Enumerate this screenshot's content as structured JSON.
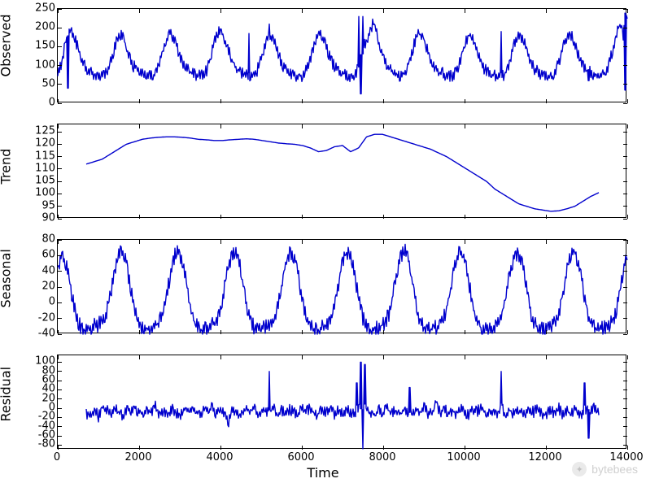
{
  "line_color": "#0000cd",
  "xlabel": "Time",
  "watermark": "bytebees",
  "chart_data": [
    {
      "type": "line",
      "ylabel": "Observed",
      "xlim": [
        0,
        14000
      ],
      "ylim": [
        0,
        250
      ],
      "xticks": [
        0,
        2000,
        4000,
        6000,
        8000,
        10000,
        12000,
        14000
      ],
      "yticks": [
        0,
        50,
        100,
        150,
        200,
        250
      ],
      "x_step": 100,
      "values": [
        80,
        120,
        180,
        200,
        180,
        150,
        120,
        100,
        90,
        85,
        80,
        80,
        95,
        130,
        170,
        190,
        175,
        140,
        110,
        95,
        85,
        80,
        80,
        80,
        100,
        135,
        175,
        195,
        180,
        145,
        115,
        100,
        90,
        85,
        82,
        80,
        100,
        140,
        180,
        200,
        185,
        150,
        120,
        100,
        90,
        85,
        80,
        80,
        95,
        130,
        170,
        190,
        175,
        140,
        110,
        95,
        85,
        80,
        80,
        80,
        100,
        135,
        175,
        195,
        180,
        145,
        115,
        100,
        90,
        85,
        82,
        80,
        95,
        130,
        170,
        190,
        230,
        175,
        140,
        110,
        95,
        85,
        80,
        80,
        100,
        135,
        175,
        195,
        180,
        145,
        115,
        100,
        90,
        85,
        82,
        80,
        95,
        130,
        170,
        190,
        175,
        140,
        110,
        95,
        85,
        80,
        80,
        80,
        95,
        130,
        170,
        190,
        175,
        140,
        110,
        95,
        85,
        80,
        80,
        80,
        100,
        135,
        175,
        195,
        180,
        145,
        115,
        100,
        90,
        85,
        82,
        80,
        95,
        130,
        170,
        225,
        190,
        240
      ],
      "spikes": [
        {
          "x": 250,
          "y": 40
        },
        {
          "x": 4700,
          "y": 185
        },
        {
          "x": 5200,
          "y": 210
        },
        {
          "x": 7400,
          "y": 230
        },
        {
          "x": 7450,
          "y": 25
        },
        {
          "x": 7500,
          "y": 230
        },
        {
          "x": 10900,
          "y": 190
        },
        {
          "x": 13050,
          "y": 60
        },
        {
          "x": 13950,
          "y": 35
        }
      ]
    },
    {
      "type": "line",
      "ylabel": "Trend",
      "xlim": [
        0,
        14000
      ],
      "ylim": [
        90,
        128
      ],
      "xticks": [
        0,
        2000,
        4000,
        6000,
        8000,
        10000,
        12000,
        14000
      ],
      "yticks": [
        90,
        95,
        100,
        105,
        110,
        115,
        120,
        125
      ],
      "x_step": 200,
      "x_start": 700,
      "x_end": 13300,
      "values": [
        112,
        113,
        114,
        116,
        118,
        120,
        121,
        122,
        122.5,
        122.8,
        123,
        123,
        122.8,
        122.5,
        122,
        121.8,
        121.5,
        121.5,
        121.8,
        122,
        122.2,
        122,
        121.5,
        121,
        120.5,
        120.2,
        120,
        119.5,
        118.5,
        117,
        117.5,
        119,
        119.5,
        117,
        118.5,
        123,
        124,
        124,
        123,
        122,
        121,
        120,
        119,
        118,
        116.5,
        115,
        113,
        111,
        109,
        107,
        105,
        102,
        100,
        98,
        96,
        95,
        94,
        93.5,
        93,
        93.2,
        94,
        95,
        97,
        99,
        100.5
      ],
      "spikes": []
    },
    {
      "type": "line",
      "ylabel": "Seasonal",
      "xlim": [
        0,
        14000
      ],
      "ylim": [
        -40,
        80
      ],
      "xticks": [
        0,
        2000,
        4000,
        6000,
        8000,
        10000,
        12000,
        14000
      ],
      "yticks": [
        -40,
        -20,
        0,
        20,
        40,
        60,
        80
      ],
      "x_step": 100,
      "values": [
        50,
        65,
        55,
        30,
        0,
        -20,
        -28,
        -30,
        -28,
        -25,
        -22,
        -20,
        -10,
        15,
        45,
        65,
        70,
        55,
        25,
        -5,
        -22,
        -28,
        -30,
        -28,
        -25,
        -20,
        -10,
        15,
        45,
        65,
        70,
        55,
        25,
        -5,
        -22,
        -28,
        -30,
        -28,
        -25,
        -20,
        -10,
        15,
        45,
        65,
        70,
        55,
        25,
        -5,
        -22,
        -28,
        -30,
        -28,
        -25,
        -20,
        -10,
        15,
        45,
        65,
        70,
        55,
        25,
        -5,
        -22,
        -28,
        -30,
        -28,
        -25,
        -20,
        -10,
        15,
        45,
        65,
        70,
        55,
        25,
        -5,
        -22,
        -28,
        -30,
        -28,
        -25,
        -20,
        -10,
        15,
        45,
        65,
        70,
        55,
        25,
        -5,
        -22,
        -28,
        -30,
        -28,
        -25,
        -20,
        -10,
        15,
        45,
        65,
        70,
        55,
        25,
        -5,
        -22,
        -28,
        -30,
        -28,
        -25,
        -20,
        -10,
        15,
        45,
        65,
        70,
        55,
        25,
        -5,
        -22,
        -28,
        -30,
        -28,
        -25,
        -20,
        -10,
        15,
        45,
        65,
        70,
        55,
        25,
        -5,
        -22,
        -28,
        -30,
        -28,
        -25,
        -20,
        -10,
        15,
        45,
        65
      ],
      "spikes": []
    },
    {
      "type": "line",
      "ylabel": "Residual",
      "xlim": [
        0,
        14000
      ],
      "ylim": [
        -90,
        115
      ],
      "xticks": [
        0,
        2000,
        4000,
        6000,
        8000,
        10000,
        12000,
        14000
      ],
      "yticks": [
        -80,
        -60,
        -40,
        -20,
        0,
        20,
        40,
        60,
        80,
        100
      ],
      "x_step": 100,
      "x_start": 700,
      "x_end": 13300,
      "values": [
        -5,
        -8,
        3,
        -12,
        8,
        2,
        -6,
        4,
        -3,
        -10,
        6,
        -2,
        8,
        -5,
        -7,
        3,
        -4,
        10,
        -8,
        2,
        -6,
        4,
        -3,
        -10,
        6,
        -2,
        8,
        -5,
        -7,
        3,
        -4,
        10,
        -8,
        2,
        -6,
        -25,
        4,
        -3,
        -10,
        6,
        -2,
        8,
        -5,
        -7,
        3,
        -4,
        10,
        -8,
        2,
        -6,
        4,
        -3,
        -10,
        6,
        -2,
        8,
        -5,
        -7,
        3,
        -4,
        10,
        -8,
        2,
        -6,
        4,
        -3,
        -10,
        6,
        -2,
        8,
        -5,
        -7,
        3,
        -4,
        10,
        -8,
        2,
        -6,
        4,
        -3,
        -10,
        6,
        -2,
        8,
        -5,
        -7,
        20,
        -4,
        10,
        -8,
        2,
        -6,
        4,
        -3,
        -10,
        6,
        -2,
        8,
        -5,
        -7,
        3,
        -4,
        10,
        -8,
        2,
        -6,
        4,
        -3,
        -10,
        6,
        -2,
        8,
        -5,
        -7,
        3,
        -4,
        10,
        -8,
        2,
        -6,
        4,
        -3,
        -10,
        6,
        -2,
        8,
        -5
      ],
      "spikes": [
        {
          "x": 5200,
          "y": 80
        },
        {
          "x": 7350,
          "y": 55
        },
        {
          "x": 7450,
          "y": 100
        },
        {
          "x": 7500,
          "y": -88
        },
        {
          "x": 7550,
          "y": 95
        },
        {
          "x": 8650,
          "y": 45
        },
        {
          "x": 10900,
          "y": 80
        },
        {
          "x": 12950,
          "y": 55
        },
        {
          "x": 13050,
          "y": -65
        }
      ]
    }
  ]
}
